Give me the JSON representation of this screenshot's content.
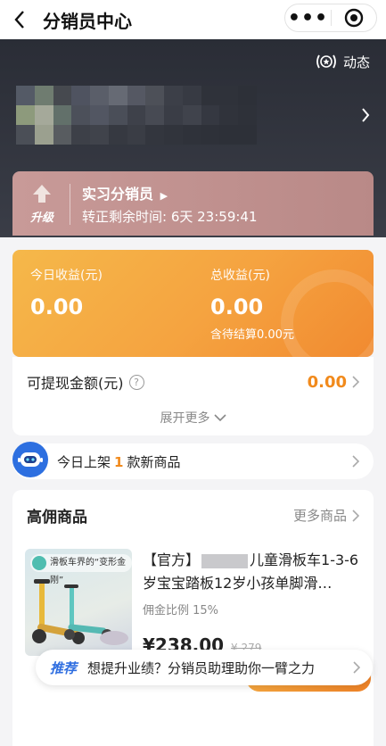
{
  "nav": {
    "title": "分销员中心",
    "more_label": "•••"
  },
  "header": {
    "dynamic_label": "动态"
  },
  "level": {
    "badge_label": "升级",
    "name": "实习分销员",
    "remaining": "转正剩余时间: 6天 23:59:41"
  },
  "income": {
    "today_label": "今日收益(元)",
    "today_value": "0.00",
    "total_label": "总收益(元)",
    "total_value": "0.00",
    "pending": "含待结算0.00元"
  },
  "withdraw": {
    "label": "可提现金额(元)",
    "amount": "0.00",
    "expand_label": "展开更多"
  },
  "new_products": {
    "prefix": "今日上架",
    "count": "1",
    "suffix": "款新商品"
  },
  "high_commission": {
    "title": "高佣商品",
    "more": "更多商品",
    "product": {
      "image_caption": "滑板车界的“变形金刚”",
      "title_prefix": "【官方】",
      "title_rest": "儿童滑板车1-3-6岁宝宝踏板12岁小孩单脚滑…",
      "ratio": "佣金比例 15%",
      "price": "¥238.00",
      "original_price": "¥ 279"
    }
  },
  "tip": {
    "tag": "推荐",
    "text": "想提升业绩？分销员助理助你一臂之力"
  },
  "colors": {
    "accent_orange": "#f18a1c",
    "brand_blue": "#2f6ee0",
    "hero_dark": "#2a2d36"
  }
}
